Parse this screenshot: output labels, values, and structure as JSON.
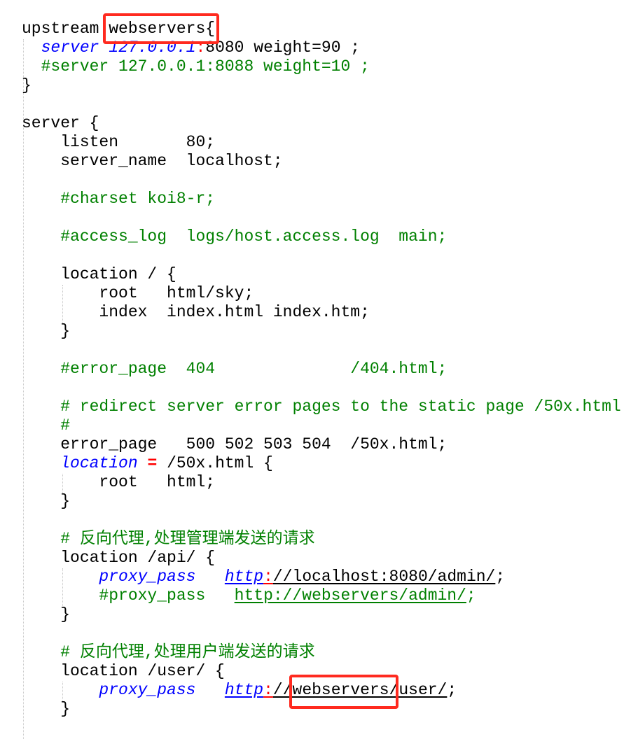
{
  "editor": {
    "highlight_color": "#ff2a1f",
    "colors": {
      "comment": "#008000",
      "keyword": "#0000ff",
      "operator": "#ff0000",
      "text": "#000000"
    },
    "lines": [
      [
        {
          "t": "upstream webservers{",
          "s": "plain"
        }
      ],
      [
        {
          "t": "  ",
          "s": "plain"
        },
        {
          "t": "server 127.0.0.1",
          "s": "keyword"
        },
        {
          "t": ":",
          "s": "colon"
        },
        {
          "t": "8080 weight=90 ;",
          "s": "plain"
        }
      ],
      [
        {
          "t": "  #server 127.0.0.1:8088 weight=10 ;",
          "s": "comment"
        }
      ],
      [
        {
          "t": "}",
          "s": "plain"
        }
      ],
      [],
      [
        {
          "t": "server {",
          "s": "plain"
        }
      ],
      [
        {
          "t": "    listen       80;",
          "s": "plain"
        }
      ],
      [
        {
          "t": "    server_name  localhost;",
          "s": "plain"
        }
      ],
      [],
      [
        {
          "t": "    #charset koi8-r;",
          "s": "comment"
        }
      ],
      [],
      [
        {
          "t": "    #access_log  logs/host.access.log  main;",
          "s": "comment"
        }
      ],
      [],
      [
        {
          "t": "    location / {",
          "s": "plain"
        }
      ],
      [
        {
          "t": "        root   html/sky;",
          "s": "plain"
        }
      ],
      [
        {
          "t": "        index  index.html index.htm;",
          "s": "plain"
        }
      ],
      [
        {
          "t": "    }",
          "s": "plain"
        }
      ],
      [],
      [
        {
          "t": "    #error_page  404              /404.html;",
          "s": "comment"
        }
      ],
      [],
      [
        {
          "t": "    # redirect server error pages to the static page /50x.html",
          "s": "comment"
        }
      ],
      [
        {
          "t": "    #",
          "s": "comment"
        }
      ],
      [
        {
          "t": "    error_page   500 502 503 504  /50x.html;",
          "s": "plain"
        }
      ],
      [
        {
          "t": "    ",
          "s": "plain"
        },
        {
          "t": "location",
          "s": "keyword"
        },
        {
          "t": " ",
          "s": "plain"
        },
        {
          "t": "=",
          "s": "op"
        },
        {
          "t": " /50x.html {",
          "s": "plain"
        }
      ],
      [
        {
          "t": "        root   html;",
          "s": "plain"
        }
      ],
      [
        {
          "t": "    }",
          "s": "plain"
        }
      ],
      [],
      [
        {
          "t": "    # 反向代理,处理管理端发送的请求",
          "s": "comment"
        }
      ],
      [
        {
          "t": "    location /api/ {",
          "s": "plain"
        }
      ],
      [
        {
          "t": "        ",
          "s": "plain"
        },
        {
          "t": "proxy_pass",
          "s": "keyword"
        },
        {
          "t": "   ",
          "s": "plain"
        },
        {
          "t": "http",
          "s": "keyword url"
        },
        {
          "t": ":",
          "s": "colon url"
        },
        {
          "t": "//localhost:8080/admin/",
          "s": "plain url"
        },
        {
          "t": ";",
          "s": "plain"
        }
      ],
      [
        {
          "t": "        #proxy_pass   ",
          "s": "comment"
        },
        {
          "t": "http://webservers/admin/",
          "s": "comment url"
        },
        {
          "t": ";",
          "s": "comment"
        }
      ],
      [
        {
          "t": "    }",
          "s": "plain"
        }
      ],
      [],
      [
        {
          "t": "    # 反向代理,处理用户端发送的请求",
          "s": "comment"
        }
      ],
      [
        {
          "t": "    location /user/ {",
          "s": "plain"
        }
      ],
      [
        {
          "t": "        ",
          "s": "plain"
        },
        {
          "t": "proxy_pass",
          "s": "keyword"
        },
        {
          "t": "   ",
          "s": "plain"
        },
        {
          "t": "http",
          "s": "keyword url"
        },
        {
          "t": ":",
          "s": "colon url"
        },
        {
          "t": "//webservers/user/",
          "s": "plain url"
        },
        {
          "t": ";",
          "s": "plain"
        }
      ],
      [
        {
          "t": "    }",
          "s": "plain"
        }
      ]
    ]
  }
}
